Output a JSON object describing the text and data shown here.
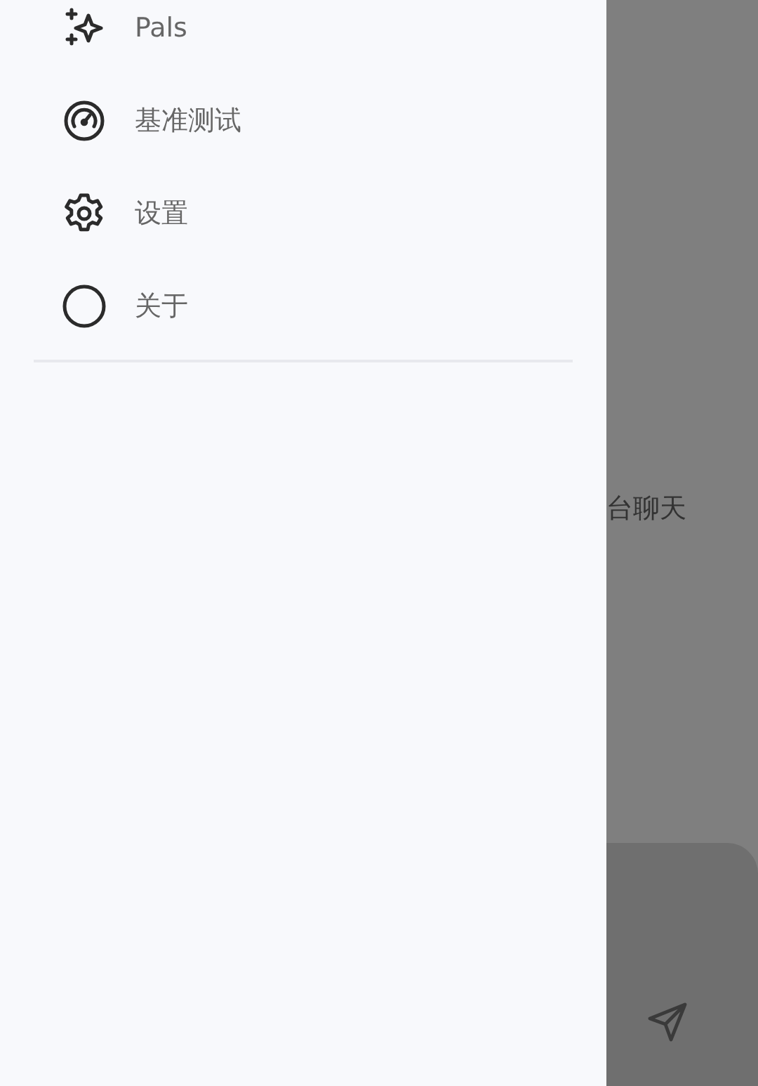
{
  "drawer": {
    "items": [
      {
        "kind": "sparkles",
        "label": "Pals"
      },
      {
        "kind": "gauge",
        "label": "基准测试"
      },
      {
        "kind": "gear",
        "label": "设置"
      },
      {
        "kind": "circle",
        "label": "关于"
      }
    ]
  },
  "chat": {
    "empty_message": "台聊天"
  }
}
